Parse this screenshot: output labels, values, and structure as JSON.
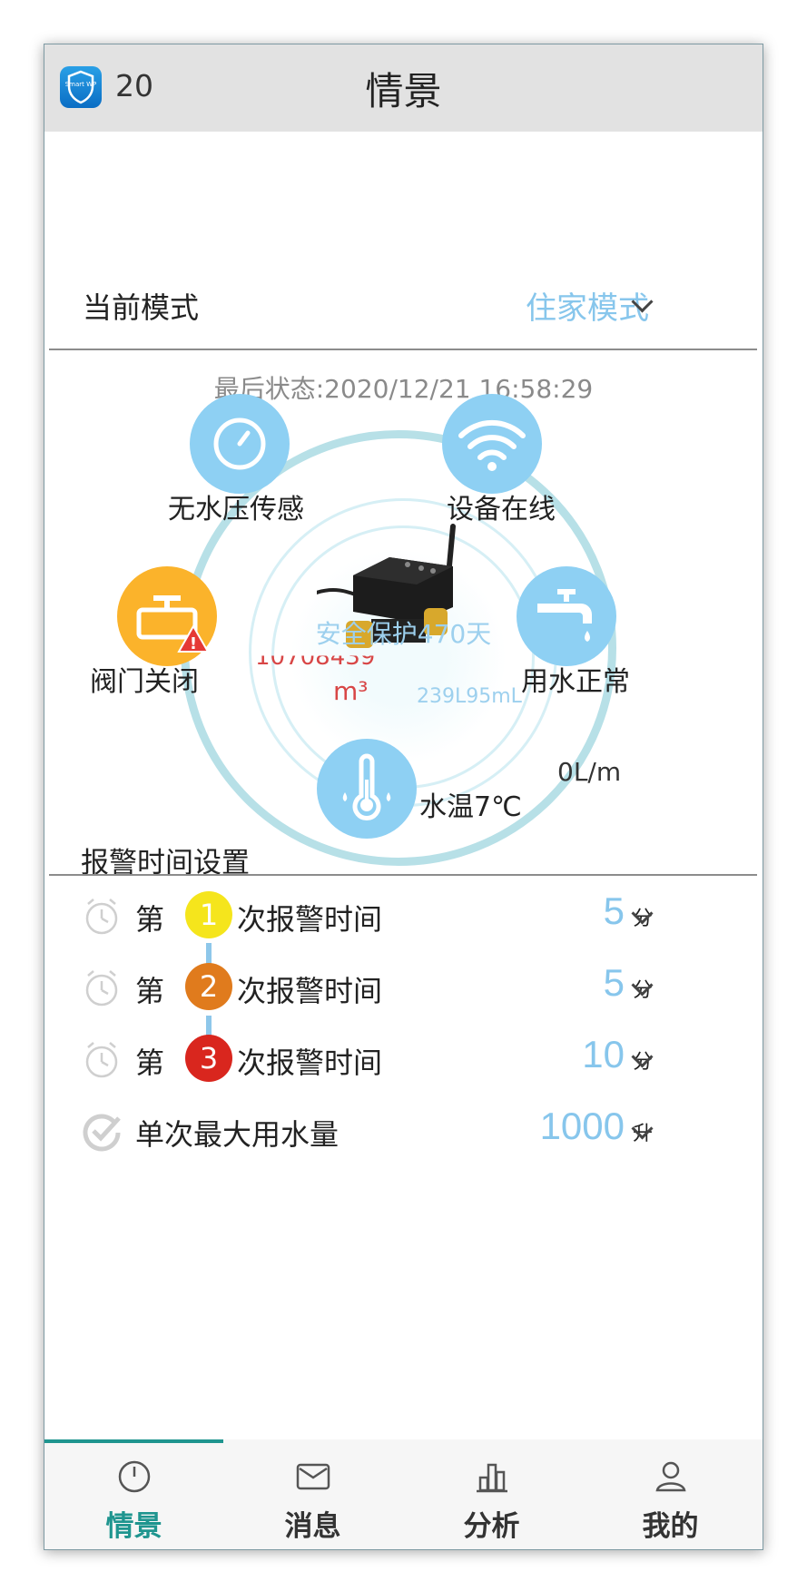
{
  "header": {
    "title": "情景",
    "count": "20",
    "logo_text": "Smart WP"
  },
  "mode": {
    "label": "当前模式",
    "value": "住家模式"
  },
  "last_status": "最后状态:2020/12/21 16:58:29",
  "status": {
    "pressure": "无水压传感",
    "online": "设备在线",
    "valve": "阀门关闭",
    "usage": "用水正常",
    "flow": "0L/m",
    "temperature": "水温7℃",
    "protect": "安全保护470天",
    "meter_value": "10708439",
    "meter_unit": "m³",
    "small_volume": "239L95mL"
  },
  "alarm": {
    "section_title": "报警时间设置",
    "rows": [
      {
        "prefix": "第",
        "index": "1",
        "suffix": "次报警时间",
        "value": "5",
        "unit": "分",
        "color": "#f5e51c"
      },
      {
        "prefix": "第",
        "index": "2",
        "suffix": "次报警时间",
        "value": "5",
        "unit": "分",
        "color": "#e07b1d"
      },
      {
        "prefix": "第",
        "index": "3",
        "suffix": "次报警时间",
        "value": "10",
        "unit": "分",
        "color": "#d9261e"
      }
    ],
    "max_usage": {
      "label": "单次最大用水量",
      "value": "1000",
      "unit": "升"
    }
  },
  "nav": {
    "items": [
      {
        "label": "情景",
        "icon": "gauge-icon"
      },
      {
        "label": "消息",
        "icon": "envelope-icon"
      },
      {
        "label": "分析",
        "icon": "bar-chart-icon"
      },
      {
        "label": "我的",
        "icon": "user-icon"
      }
    ],
    "active_color": "#1f958f"
  }
}
